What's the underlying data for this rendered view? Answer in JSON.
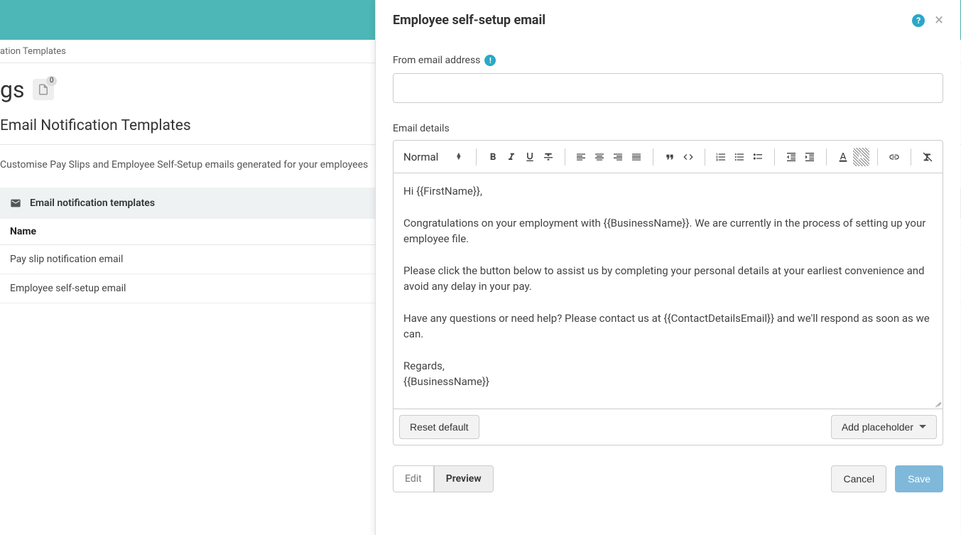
{
  "background": {
    "breadcrumb": "ation Templates",
    "page_title_suffix": "gs",
    "badge_count": "0",
    "section_title": "Email Notification Templates",
    "section_desc": "Customise Pay Slips and Employee Self-Setup emails generated for your employees",
    "table_header": "Email notification templates",
    "col_name": "Name",
    "rows": [
      {
        "name": "Pay slip notification email"
      },
      {
        "name": "Employee self-setup email"
      }
    ]
  },
  "modal": {
    "title": "Employee self-setup email",
    "help_char": "?",
    "close_char": "×",
    "from_label": "From email address",
    "from_info_char": "!",
    "from_value": "",
    "details_label": "Email details",
    "format_label": "Normal",
    "body": {
      "p1": "Hi {{FirstName}},",
      "p2": "Congratulations on your employment with {{BusinessName}}. We are currently in the process of setting up your employee file.",
      "p3": "Please click the button below to assist us by completing your personal details at your earliest convenience and avoid any delay in your pay.",
      "p4": "Have any questions or need help? Please contact us at {{ContactDetailsEmail}} and we'll respond as soon as we can.",
      "p5": "Regards,\n{{BusinessName}}"
    },
    "reset_label": "Reset default",
    "add_placeholder_label": "Add placeholder",
    "edit_label": "Edit",
    "preview_label": "Preview",
    "cancel_label": "Cancel",
    "save_label": "Save"
  }
}
